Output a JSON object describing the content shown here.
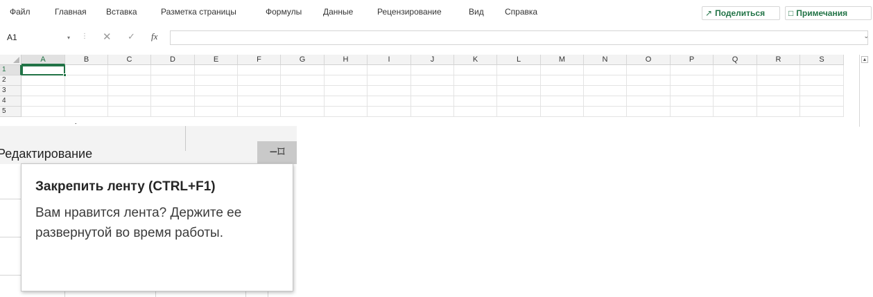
{
  "menu": {
    "items": [
      "Файл",
      "Главная",
      "Вставка",
      "Разметка страницы",
      "Формулы",
      "Данные",
      "Рецензирование",
      "Вид",
      "Справка"
    ],
    "share_label": "Поделиться",
    "notes_label": "Примечания"
  },
  "formula_bar": {
    "name_box": "A1",
    "formula": "",
    "fx_label": "fx"
  },
  "grid": {
    "columns": [
      "A",
      "B",
      "C",
      "D",
      "E",
      "F",
      "G",
      "H",
      "I",
      "J",
      "K",
      "L",
      "M",
      "N",
      "O",
      "P",
      "Q",
      "R",
      "S"
    ],
    "rows": [
      "1",
      "2",
      "3",
      "4",
      "5"
    ],
    "active_cell": "A1"
  },
  "zoom": {
    "group_label": "Редактирование",
    "tooltip_title": "Закрепить ленту (CTRL+F1)",
    "tooltip_body": "Вам нравится лента? Держите ее развернутой во время работы."
  },
  "colors": {
    "accent": "#217346",
    "ribbon_bg": "#f3f3f3",
    "pin_bg": "#c9c9c9"
  }
}
